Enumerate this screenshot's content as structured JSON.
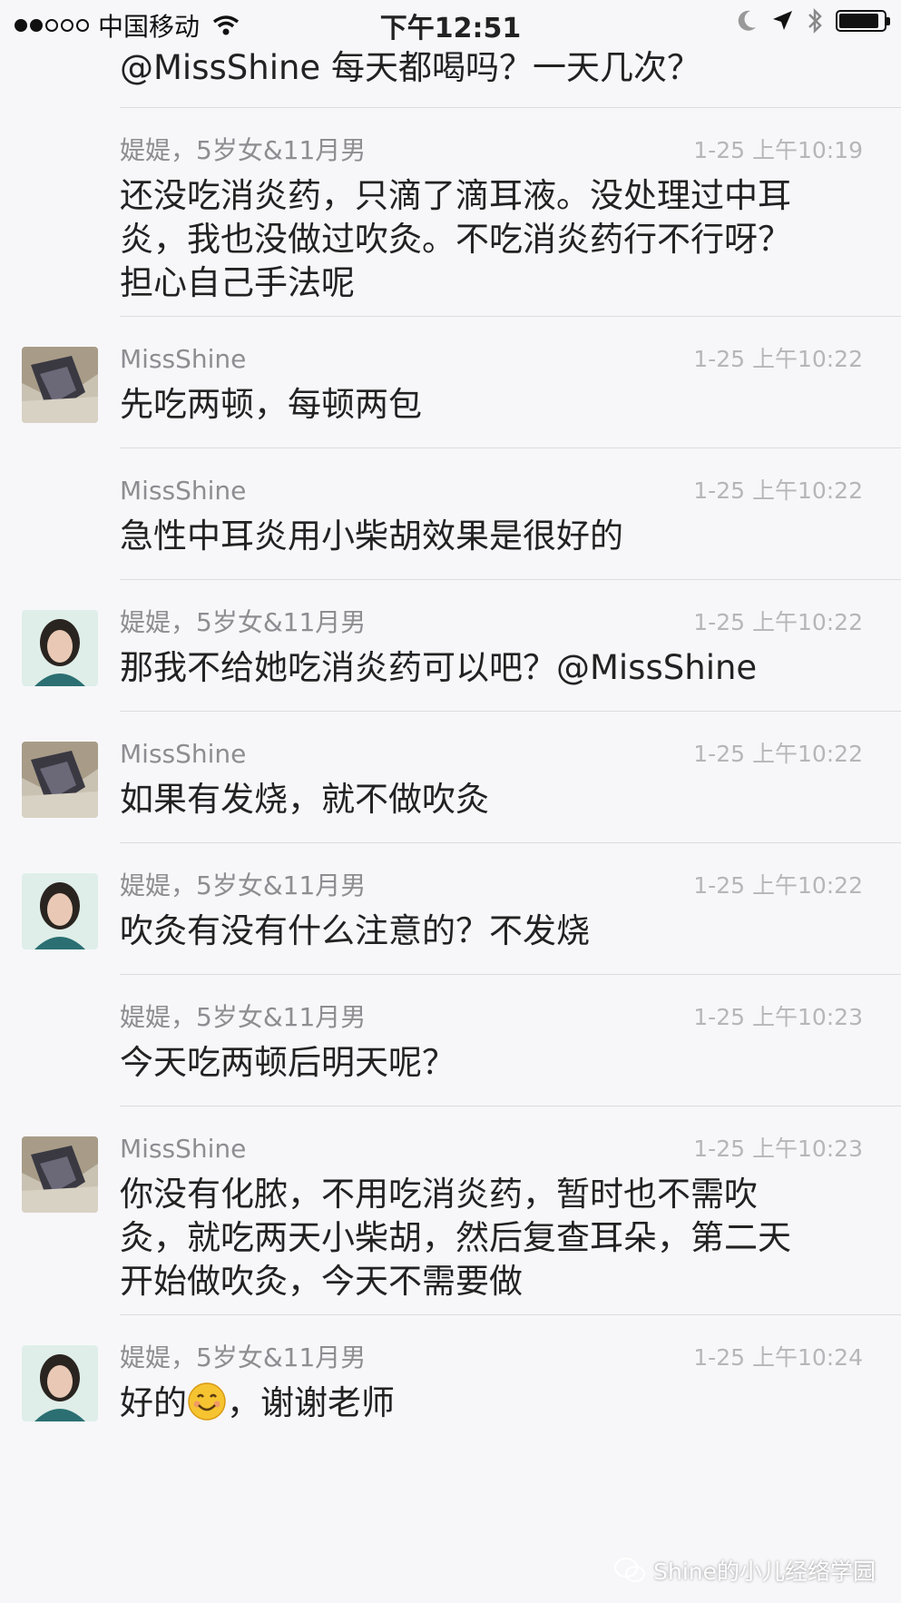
{
  "status_bar": {
    "carrier": "中国移动",
    "time": "下午12:51",
    "signal_dots": 5,
    "signal_filled": 2,
    "battery_level": 0.9
  },
  "top_text": "@MissShine 每天都喝吗？一天几次？",
  "messages": [
    {
      "avatar": "none",
      "name": "媞媞，5岁女&11月男",
      "time": "1-25 上午10:19",
      "text": "还没吃消炎药，只滴了滴耳液。没处理过中耳\n炎，我也没做过吹灸。不吃消炎药行不行呀？\n担心自己手法呢"
    },
    {
      "avatar": "misshine",
      "name": "MissShine",
      "time": "1-25 上午10:22",
      "text": "先吃两顿，每顿两包"
    },
    {
      "avatar": "none",
      "name": "MissShine",
      "time": "1-25 上午10:22",
      "text": "急性中耳炎用小柴胡效果是很好的"
    },
    {
      "avatar": "titi",
      "name": "媞媞，5岁女&11月男",
      "time": "1-25 上午10:22",
      "text": "那我不给她吃消炎药可以吧？@MissShine"
    },
    {
      "avatar": "misshine",
      "name": "MissShine",
      "time": "1-25 上午10:22",
      "text": "如果有发烧，就不做吹灸"
    },
    {
      "avatar": "titi",
      "name": "媞媞，5岁女&11月男",
      "time": "1-25 上午10:22",
      "text": "吹灸有没有什么注意的？不发烧"
    },
    {
      "avatar": "none",
      "name": "媞媞，5岁女&11月男",
      "time": "1-25 上午10:23",
      "text": "今天吃两顿后明天呢？"
    },
    {
      "avatar": "misshine",
      "name": "MissShine",
      "time": "1-25 上午10:23",
      "text": "你没有化脓，不用吃消炎药，暂时也不需吹\n灸，就吃两天小柴胡，然后复查耳朵，第二天\n开始做吹灸，今天不需要做"
    },
    {
      "avatar": "titi",
      "name": "媞媞，5岁女&11月男",
      "time": "1-25 上午10:24",
      "text_before": "好的",
      "text_after": "，谢谢老师"
    }
  ],
  "watermark": "Shine的小儿经络学园",
  "colors": {
    "background": "#f7f7f9",
    "divider": "#dcdcdf",
    "name": "#8d8d92",
    "time": "#b6b6ba"
  }
}
